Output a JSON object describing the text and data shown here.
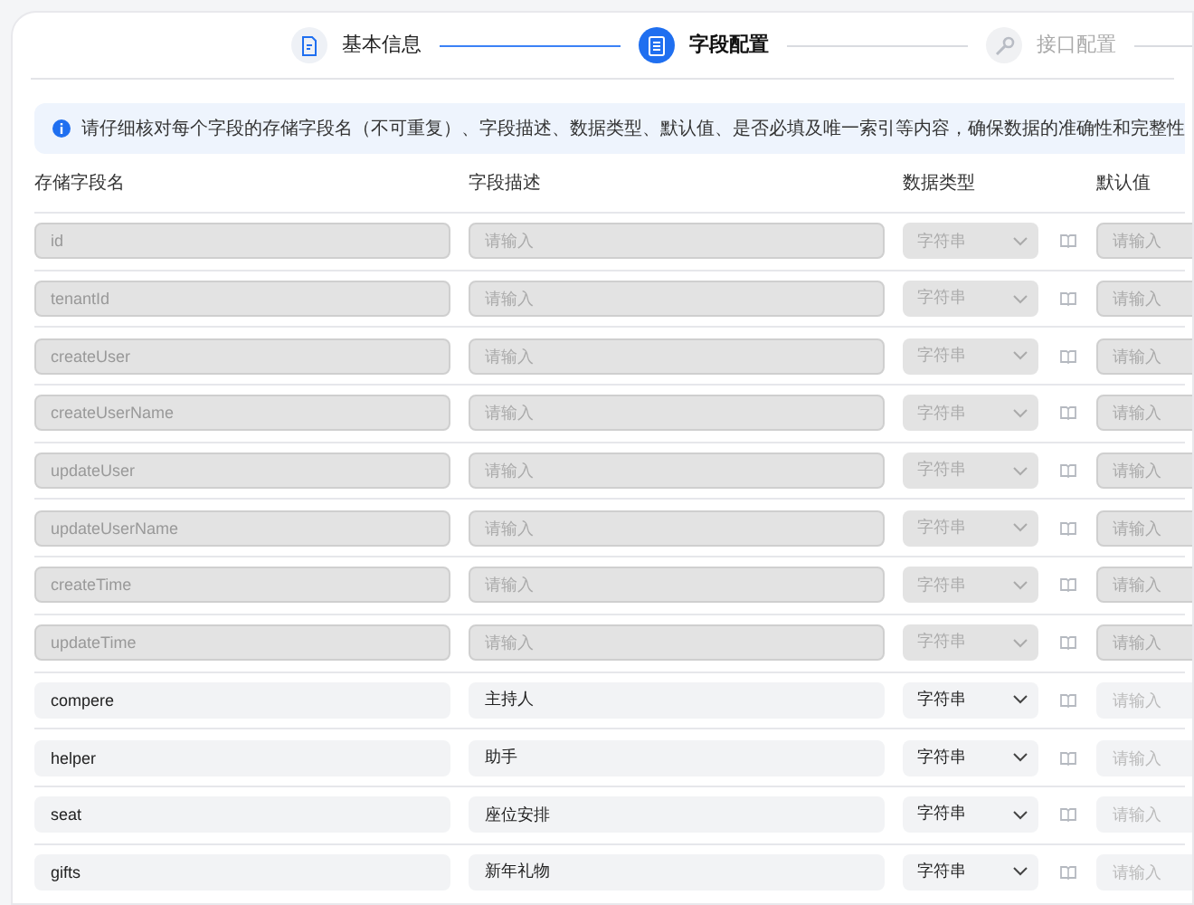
{
  "steps": [
    {
      "label": "基本信息",
      "completed": true,
      "selected": false
    },
    {
      "label": "字段配置",
      "completed": false,
      "selected": true
    },
    {
      "label": "接口配置",
      "completed": false,
      "selected": false
    }
  ],
  "notice": "请仔细核对每个字段的存储字段名（不可重复）、字段描述、数据类型、默认值、是否必填及唯一索引等内容，确保数据的准确性和完整性",
  "table": {
    "columns": [
      "存储字段名",
      "字段描述",
      "数据类型",
      "默认值"
    ],
    "rows": [
      {
        "name": "id",
        "description": {
          "placeholder": "请输入"
        },
        "type": "字符串",
        "default": {
          "placeholder": "请输入"
        },
        "disabled": true
      },
      {
        "name": "tenantId",
        "description": {
          "placeholder": "请输入"
        },
        "type": "字符串",
        "default": {
          "placeholder": "请输入"
        },
        "disabled": true
      },
      {
        "name": "createUser",
        "description": {
          "placeholder": "请输入"
        },
        "type": "字符串",
        "default": {
          "placeholder": "请输入"
        },
        "disabled": true
      },
      {
        "name": "createUserName",
        "description": {
          "placeholder": "请输入"
        },
        "type": "字符串",
        "default": {
          "placeholder": "请输入"
        },
        "disabled": true
      },
      {
        "name": "updateUser",
        "description": {
          "placeholder": "请输入"
        },
        "type": "字符串",
        "default": {
          "placeholder": "请输入"
        },
        "disabled": true
      },
      {
        "name": "updateUserName",
        "description": {
          "placeholder": "请输入"
        },
        "type": "字符串",
        "default": {
          "placeholder": "请输入"
        },
        "disabled": true
      },
      {
        "name": "createTime",
        "description": {
          "placeholder": "请输入"
        },
        "type": "字符串",
        "default": {
          "placeholder": "请输入"
        },
        "disabled": true
      },
      {
        "name": "updateTime",
        "description": {
          "placeholder": "请输入"
        },
        "type": "字符串",
        "default": {
          "placeholder": "请输入"
        },
        "disabled": true
      },
      {
        "name": "compere",
        "description": {
          "value": "主持人"
        },
        "type": "字符串",
        "default": {
          "placeholder": "请输入"
        },
        "disabled": false
      },
      {
        "name": "helper",
        "description": {
          "value": "助手"
        },
        "type": "字符串",
        "default": {
          "placeholder": "请输入"
        },
        "disabled": false
      },
      {
        "name": "seat",
        "description": {
          "value": "座位安排"
        },
        "type": "字符串",
        "default": {
          "placeholder": "请输入"
        },
        "disabled": false
      },
      {
        "name": "gifts",
        "description": {
          "value": "新年礼物"
        },
        "type": "字符串",
        "default": {
          "placeholder": "请输入"
        },
        "disabled": false
      }
    ]
  }
}
